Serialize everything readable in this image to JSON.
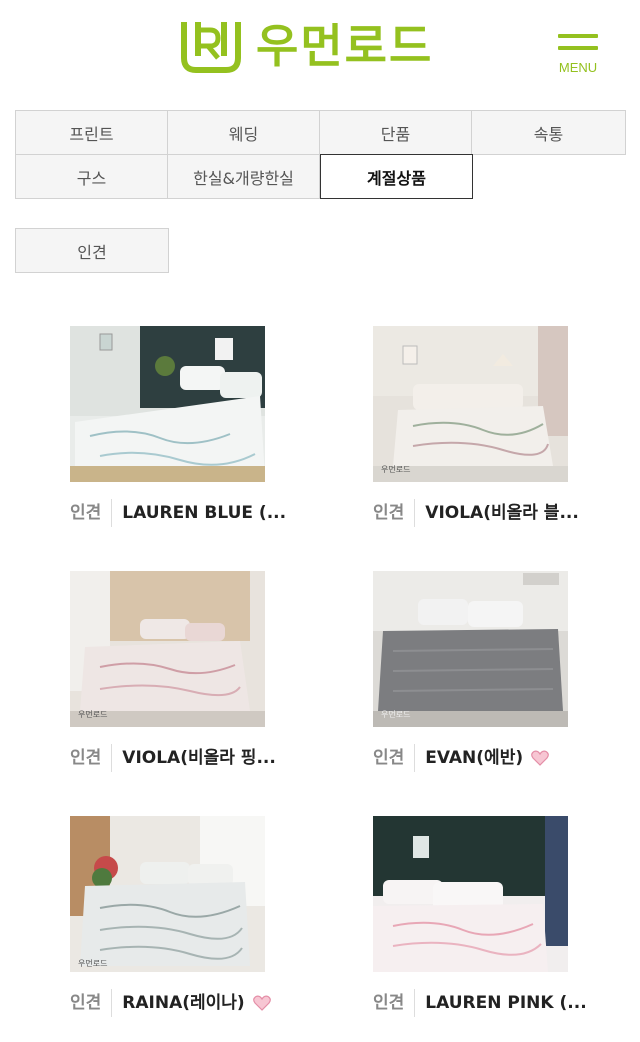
{
  "header": {
    "brand": "우먼로드",
    "logo_mark": "W",
    "menu_label": "MENU",
    "accent_color": "#94c11f"
  },
  "categories": [
    {
      "label": "프린트"
    },
    {
      "label": "웨딩"
    },
    {
      "label": "단품"
    },
    {
      "label": "속통"
    },
    {
      "label": "구스"
    },
    {
      "label": "한실&개량한실"
    },
    {
      "label": "계절상품",
      "active": true
    }
  ],
  "sub_tab": {
    "label": "인견"
  },
  "products": [
    {
      "category": "인견",
      "name": "LAUREN BLUE (...",
      "wishlist": false
    },
    {
      "category": "인견",
      "name": "VIOLA(비올라 블...",
      "wishlist": false
    },
    {
      "category": "인견",
      "name": "VIOLA(비올라 핑...",
      "wishlist": false
    },
    {
      "category": "인견",
      "name": "EVAN(에반)",
      "wishlist": true
    },
    {
      "category": "인견",
      "name": "RAINA(레이나)",
      "wishlist": true
    },
    {
      "category": "인견",
      "name": "LAUREN PINK (...",
      "wishlist": false
    }
  ]
}
